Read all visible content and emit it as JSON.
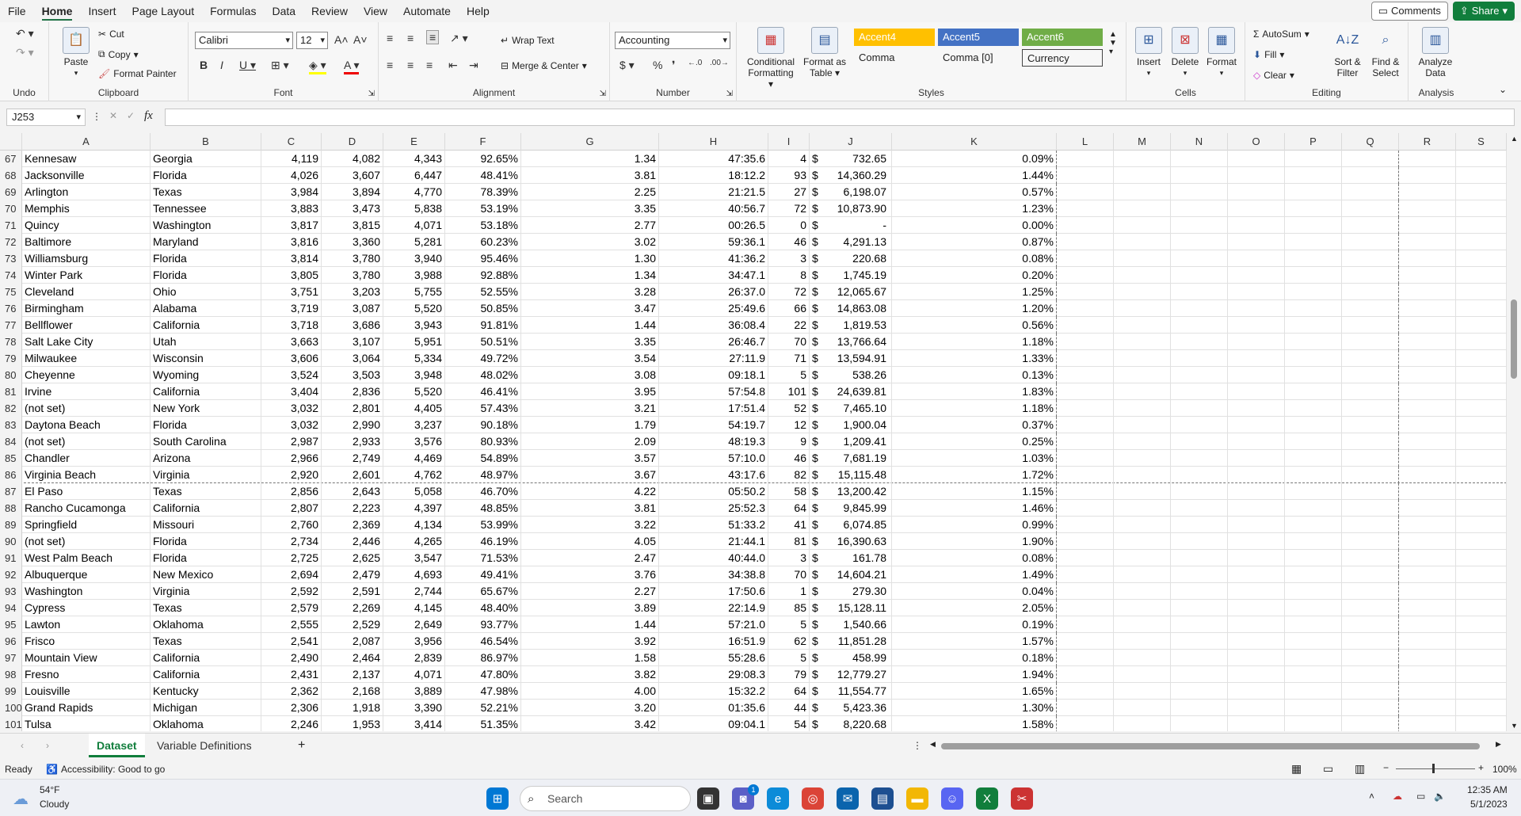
{
  "menu": {
    "tabs": [
      "File",
      "Home",
      "Insert",
      "Page Layout",
      "Formulas",
      "Data",
      "Review",
      "View",
      "Automate",
      "Help"
    ],
    "active": "Home"
  },
  "top_buttons": {
    "comments": "Comments",
    "share": "Share"
  },
  "ribbon": {
    "undo_group": "Undo",
    "clipboard": {
      "label": "Clipboard",
      "paste": "Paste",
      "cut": "Cut",
      "copy": "Copy",
      "format_painter": "Format Painter"
    },
    "font": {
      "label": "Font",
      "name": "Calibri",
      "size": "12"
    },
    "alignment": {
      "label": "Alignment",
      "wrap": "Wrap Text",
      "merge": "Merge & Center"
    },
    "number": {
      "label": "Number",
      "format": "Accounting"
    },
    "styles": {
      "label": "Styles",
      "conditional": "Conditional Formatting",
      "format_table": "Format as Table",
      "accent4": "Accent4",
      "accent5": "Accent5",
      "accent6": "Accent6",
      "comma": "Comma",
      "comma0": "Comma [0]",
      "currency": "Currency"
    },
    "cells": {
      "label": "Cells",
      "insert": "Insert",
      "delete": "Delete",
      "format": "Format"
    },
    "editing": {
      "label": "Editing",
      "autosum": "AutoSum",
      "fill": "Fill",
      "clear": "Clear",
      "sort": "Sort & Filter",
      "find": "Find & Select"
    },
    "analysis": {
      "label": "Analysis",
      "analyze": "Analyze Data"
    }
  },
  "formula_bar": {
    "name_box": "J253",
    "fx": "fx",
    "value": ""
  },
  "columns": [
    "A",
    "B",
    "C",
    "D",
    "E",
    "F",
    "G",
    "H",
    "I",
    "J",
    "K",
    "L",
    "M",
    "N",
    "O",
    "P",
    "Q",
    "R",
    "S"
  ],
  "rows": [
    {
      "n": "67",
      "a": "Kennesaw",
      "b": "Georgia",
      "c": "4,119",
      "d": "4,082",
      "e": "4,343",
      "f": "92.65%",
      "g": "1.34",
      "h": "47:35.6",
      "i": "4",
      "j": "732.65",
      "k": "0.09%"
    },
    {
      "n": "68",
      "a": "Jacksonville",
      "b": "Florida",
      "c": "4,026",
      "d": "3,607",
      "e": "6,447",
      "f": "48.41%",
      "g": "3.81",
      "h": "18:12.2",
      "i": "93",
      "j": "14,360.29",
      "k": "1.44%"
    },
    {
      "n": "69",
      "a": "Arlington",
      "b": "Texas",
      "c": "3,984",
      "d": "3,894",
      "e": "4,770",
      "f": "78.39%",
      "g": "2.25",
      "h": "21:21.5",
      "i": "27",
      "j": "6,198.07",
      "k": "0.57%"
    },
    {
      "n": "70",
      "a": "Memphis",
      "b": "Tennessee",
      "c": "3,883",
      "d": "3,473",
      "e": "5,838",
      "f": "53.19%",
      "g": "3.35",
      "h": "40:56.7",
      "i": "72",
      "j": "10,873.90",
      "k": "1.23%"
    },
    {
      "n": "71",
      "a": "Quincy",
      "b": "Washington",
      "c": "3,817",
      "d": "3,815",
      "e": "4,071",
      "f": "53.18%",
      "g": "2.77",
      "h": "00:26.5",
      "i": "0",
      "j": "-",
      "k": "0.00%"
    },
    {
      "n": "72",
      "a": "Baltimore",
      "b": "Maryland",
      "c": "3,816",
      "d": "3,360",
      "e": "5,281",
      "f": "60.23%",
      "g": "3.02",
      "h": "59:36.1",
      "i": "46",
      "j": "4,291.13",
      "k": "0.87%"
    },
    {
      "n": "73",
      "a": "Williamsburg",
      "b": "Florida",
      "c": "3,814",
      "d": "3,780",
      "e": "3,940",
      "f": "95.46%",
      "g": "1.30",
      "h": "41:36.2",
      "i": "3",
      "j": "220.68",
      "k": "0.08%"
    },
    {
      "n": "74",
      "a": "Winter Park",
      "b": "Florida",
      "c": "3,805",
      "d": "3,780",
      "e": "3,988",
      "f": "92.88%",
      "g": "1.34",
      "h": "34:47.1",
      "i": "8",
      "j": "1,745.19",
      "k": "0.20%"
    },
    {
      "n": "75",
      "a": "Cleveland",
      "b": "Ohio",
      "c": "3,751",
      "d": "3,203",
      "e": "5,755",
      "f": "52.55%",
      "g": "3.28",
      "h": "26:37.0",
      "i": "72",
      "j": "12,065.67",
      "k": "1.25%"
    },
    {
      "n": "76",
      "a": "Birmingham",
      "b": "Alabama",
      "c": "3,719",
      "d": "3,087",
      "e": "5,520",
      "f": "50.85%",
      "g": "3.47",
      "h": "25:49.6",
      "i": "66",
      "j": "14,863.08",
      "k": "1.20%"
    },
    {
      "n": "77",
      "a": "Bellflower",
      "b": "California",
      "c": "3,718",
      "d": "3,686",
      "e": "3,943",
      "f": "91.81%",
      "g": "1.44",
      "h": "36:08.4",
      "i": "22",
      "j": "1,819.53",
      "k": "0.56%"
    },
    {
      "n": "78",
      "a": "Salt Lake City",
      "b": "Utah",
      "c": "3,663",
      "d": "3,107",
      "e": "5,951",
      "f": "50.51%",
      "g": "3.35",
      "h": "26:46.7",
      "i": "70",
      "j": "13,766.64",
      "k": "1.18%"
    },
    {
      "n": "79",
      "a": "Milwaukee",
      "b": "Wisconsin",
      "c": "3,606",
      "d": "3,064",
      "e": "5,334",
      "f": "49.72%",
      "g": "3.54",
      "h": "27:11.9",
      "i": "71",
      "j": "13,594.91",
      "k": "1.33%"
    },
    {
      "n": "80",
      "a": "Cheyenne",
      "b": "Wyoming",
      "c": "3,524",
      "d": "3,503",
      "e": "3,948",
      "f": "48.02%",
      "g": "3.08",
      "h": "09:18.1",
      "i": "5",
      "j": "538.26",
      "k": "0.13%"
    },
    {
      "n": "81",
      "a": "Irvine",
      "b": "California",
      "c": "3,404",
      "d": "2,836",
      "e": "5,520",
      "f": "46.41%",
      "g": "3.95",
      "h": "57:54.8",
      "i": "101",
      "j": "24,639.81",
      "k": "1.83%"
    },
    {
      "n": "82",
      "a": "(not set)",
      "b": "New York",
      "c": "3,032",
      "d": "2,801",
      "e": "4,405",
      "f": "57.43%",
      "g": "3.21",
      "h": "17:51.4",
      "i": "52",
      "j": "7,465.10",
      "k": "1.18%"
    },
    {
      "n": "83",
      "a": "Daytona Beach",
      "b": "Florida",
      "c": "3,032",
      "d": "2,990",
      "e": "3,237",
      "f": "90.18%",
      "g": "1.79",
      "h": "54:19.7",
      "i": "12",
      "j": "1,900.04",
      "k": "0.37%"
    },
    {
      "n": "84",
      "a": "(not set)",
      "b": "South Carolina",
      "c": "2,987",
      "d": "2,933",
      "e": "3,576",
      "f": "80.93%",
      "g": "2.09",
      "h": "48:19.3",
      "i": "9",
      "j": "1,209.41",
      "k": "0.25%"
    },
    {
      "n": "85",
      "a": "Chandler",
      "b": "Arizona",
      "c": "2,966",
      "d": "2,749",
      "e": "4,469",
      "f": "54.89%",
      "g": "3.57",
      "h": "57:10.0",
      "i": "46",
      "j": "7,681.19",
      "k": "1.03%"
    },
    {
      "n": "86",
      "a": "Virginia Beach",
      "b": "Virginia",
      "c": "2,920",
      "d": "2,601",
      "e": "4,762",
      "f": "48.97%",
      "g": "3.67",
      "h": "43:17.6",
      "i": "82",
      "j": "15,115.48",
      "k": "1.72%"
    },
    {
      "n": "87",
      "a": "El Paso",
      "b": "Texas",
      "c": "2,856",
      "d": "2,643",
      "e": "5,058",
      "f": "46.70%",
      "g": "4.22",
      "h": "05:50.2",
      "i": "58",
      "j": "13,200.42",
      "k": "1.15%"
    },
    {
      "n": "88",
      "a": "Rancho Cucamonga",
      "b": "California",
      "c": "2,807",
      "d": "2,223",
      "e": "4,397",
      "f": "48.85%",
      "g": "3.81",
      "h": "25:52.3",
      "i": "64",
      "j": "9,845.99",
      "k": "1.46%"
    },
    {
      "n": "89",
      "a": "Springfield",
      "b": "Missouri",
      "c": "2,760",
      "d": "2,369",
      "e": "4,134",
      "f": "53.99%",
      "g": "3.22",
      "h": "51:33.2",
      "i": "41",
      "j": "6,074.85",
      "k": "0.99%"
    },
    {
      "n": "90",
      "a": "(not set)",
      "b": "Florida",
      "c": "2,734",
      "d": "2,446",
      "e": "4,265",
      "f": "46.19%",
      "g": "4.05",
      "h": "21:44.1",
      "i": "81",
      "j": "16,390.63",
      "k": "1.90%"
    },
    {
      "n": "91",
      "a": "West Palm Beach",
      "b": "Florida",
      "c": "2,725",
      "d": "2,625",
      "e": "3,547",
      "f": "71.53%",
      "g": "2.47",
      "h": "40:44.0",
      "i": "3",
      "j": "161.78",
      "k": "0.08%"
    },
    {
      "n": "92",
      "a": "Albuquerque",
      "b": "New Mexico",
      "c": "2,694",
      "d": "2,479",
      "e": "4,693",
      "f": "49.41%",
      "g": "3.76",
      "h": "34:38.8",
      "i": "70",
      "j": "14,604.21",
      "k": "1.49%"
    },
    {
      "n": "93",
      "a": "Washington",
      "b": "Virginia",
      "c": "2,592",
      "d": "2,591",
      "e": "2,744",
      "f": "65.67%",
      "g": "2.27",
      "h": "17:50.6",
      "i": "1",
      "j": "279.30",
      "k": "0.04%"
    },
    {
      "n": "94",
      "a": "Cypress",
      "b": "Texas",
      "c": "2,579",
      "d": "2,269",
      "e": "4,145",
      "f": "48.40%",
      "g": "3.89",
      "h": "22:14.9",
      "i": "85",
      "j": "15,128.11",
      "k": "2.05%"
    },
    {
      "n": "95",
      "a": "Lawton",
      "b": "Oklahoma",
      "c": "2,555",
      "d": "2,529",
      "e": "2,649",
      "f": "93.77%",
      "g": "1.44",
      "h": "57:21.0",
      "i": "5",
      "j": "1,540.66",
      "k": "0.19%"
    },
    {
      "n": "96",
      "a": "Frisco",
      "b": "Texas",
      "c": "2,541",
      "d": "2,087",
      "e": "3,956",
      "f": "46.54%",
      "g": "3.92",
      "h": "16:51.9",
      "i": "62",
      "j": "11,851.28",
      "k": "1.57%"
    },
    {
      "n": "97",
      "a": "Mountain View",
      "b": "California",
      "c": "2,490",
      "d": "2,464",
      "e": "2,839",
      "f": "86.97%",
      "g": "1.58",
      "h": "55:28.6",
      "i": "5",
      "j": "458.99",
      "k": "0.18%"
    },
    {
      "n": "98",
      "a": "Fresno",
      "b": "California",
      "c": "2,431",
      "d": "2,137",
      "e": "4,071",
      "f": "47.80%",
      "g": "3.82",
      "h": "29:08.3",
      "i": "79",
      "j": "12,779.27",
      "k": "1.94%"
    },
    {
      "n": "99",
      "a": "Louisville",
      "b": "Kentucky",
      "c": "2,362",
      "d": "2,168",
      "e": "3,889",
      "f": "47.98%",
      "g": "4.00",
      "h": "15:32.2",
      "i": "64",
      "j": "11,554.77",
      "k": "1.65%"
    },
    {
      "n": "100",
      "a": "Grand Rapids",
      "b": "Michigan",
      "c": "2,306",
      "d": "1,918",
      "e": "3,390",
      "f": "52.21%",
      "g": "3.20",
      "h": "01:35.6",
      "i": "44",
      "j": "5,423.36",
      "k": "1.30%"
    },
    {
      "n": "101",
      "a": "Tulsa",
      "b": "Oklahoma",
      "c": "2,246",
      "d": "1,953",
      "e": "3,414",
      "f": "51.35%",
      "g": "3.42",
      "h": "09:04.1",
      "i": "54",
      "j": "8,220.68",
      "k": "1.58%"
    }
  ],
  "currency_symbol": "$",
  "sheets": [
    "Dataset",
    "Variable Definitions"
  ],
  "status": {
    "ready": "Ready",
    "accessibility": "Accessibility: Good to go",
    "zoom": "100%"
  },
  "taskbar": {
    "temp": "54°F",
    "weather": "Cloudy",
    "search": "Search",
    "time": "12:35 AM",
    "date": "5/1/2023",
    "badge": "1"
  },
  "colors": {
    "excel_green": "#117e3c",
    "accent4": "#ffc000",
    "accent5": "#4472c4",
    "accent6": "#70ad47"
  }
}
